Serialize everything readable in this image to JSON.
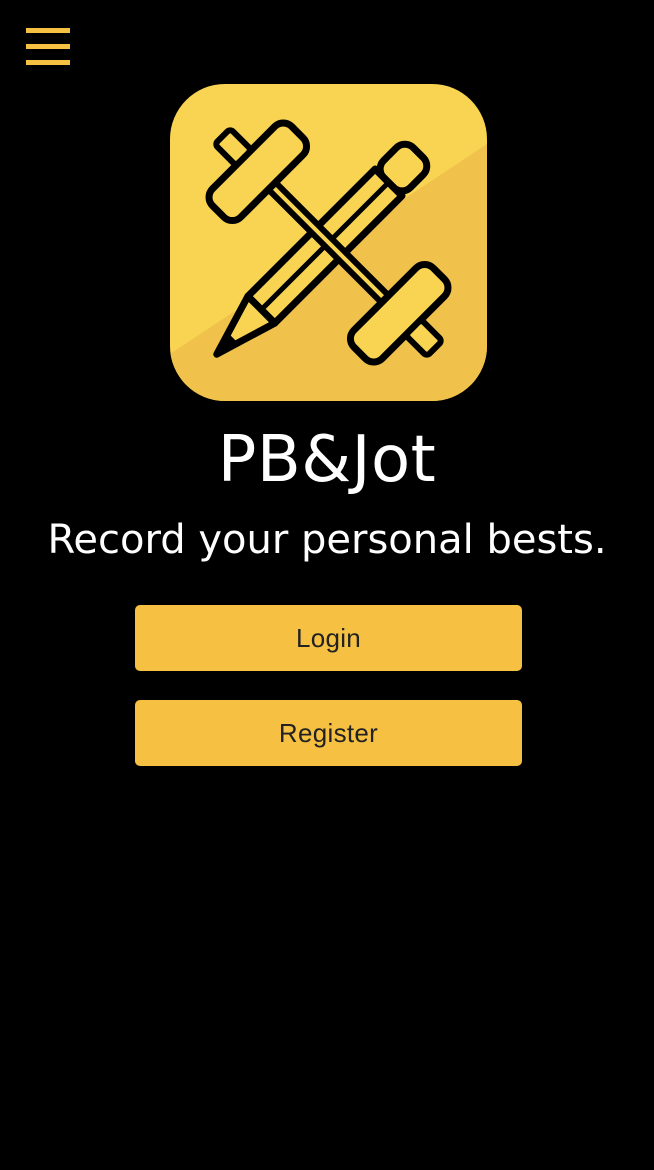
{
  "header": {
    "menu_icon": "hamburger-menu-icon"
  },
  "logo": {
    "icon": "barbell-and-pencil-logo",
    "colors": {
      "background_light": "#f8d452",
      "background_dark": "#f0c14b",
      "outline": "#000000"
    }
  },
  "hero": {
    "title": "PB&Jot",
    "tagline": "Record your personal bests."
  },
  "actions": {
    "login_label": "Login",
    "register_label": "Register"
  },
  "theme": {
    "background": "#000000",
    "accent": "#f6c142",
    "text": "#ffffff",
    "button_text": "#222222"
  }
}
